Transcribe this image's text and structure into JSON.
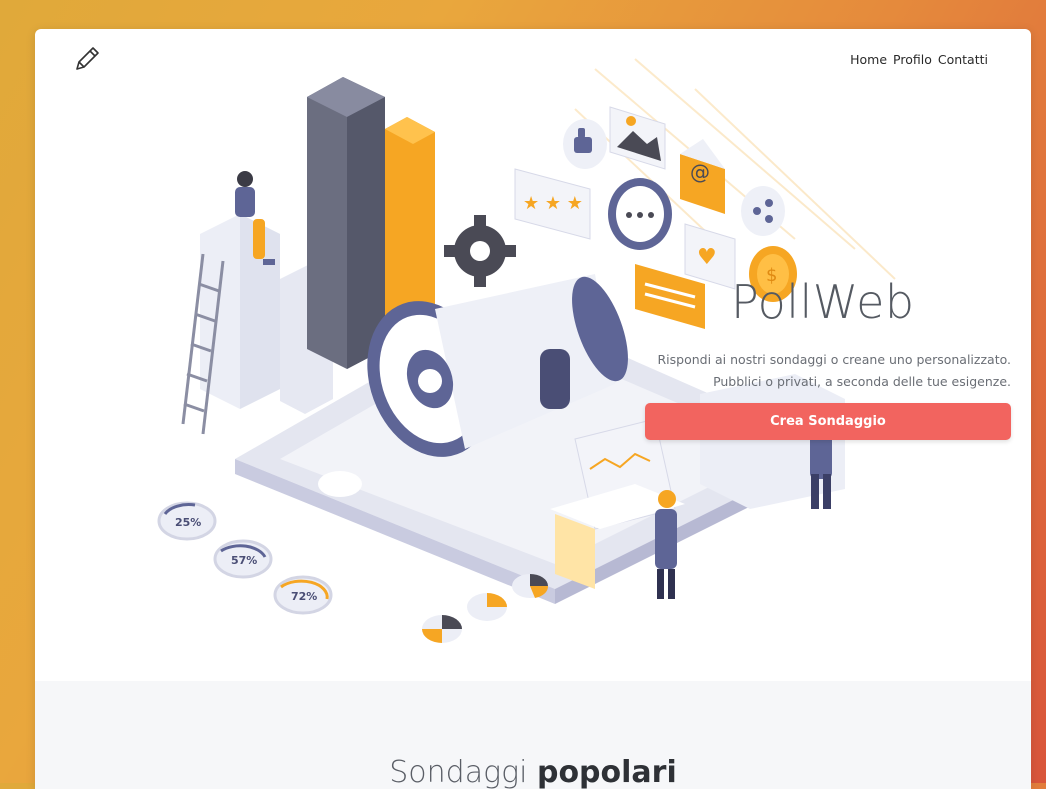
{
  "nav": {
    "items": [
      "Home",
      "Profilo",
      "Contatti"
    ]
  },
  "hero": {
    "brand": "PollWeb",
    "tagline_line1": "Rispondi ai nostri sondaggi o creane uno personalizzato.",
    "tagline_line2": "Pubblici o privati, a seconda delle tue esigenze.",
    "cta_label": "Crea Sondaggio",
    "art_badges": [
      "25%",
      "57%",
      "72%"
    ]
  },
  "popular": {
    "title_part1": "Sondaggi",
    "title_part2": "popolari"
  },
  "colors": {
    "accent": "#f2645f",
    "orange": "#f6a623",
    "slate": "#6b6e8c"
  },
  "icons": [
    "pencil-icon",
    "gear-icon",
    "megaphone-icon",
    "star-icon",
    "thumbs-up-icon",
    "image-icon",
    "at-sign-icon",
    "share-icon",
    "chat-bubble-icon",
    "heart-icon",
    "dollar-coin-icon"
  ]
}
